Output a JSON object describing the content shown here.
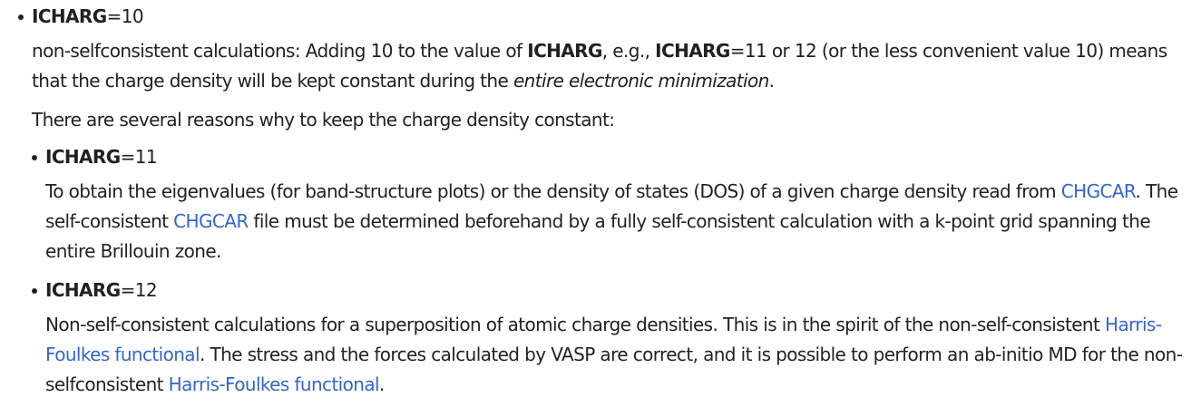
{
  "outer": {
    "param": "ICHARG",
    "value": "=10",
    "desc": {
      "t1": "non-selfconsistent calculations: Adding 10 to the value of ",
      "b1": "ICHARG",
      "t2": ", e.g., ",
      "b2": "ICHARG",
      "t3": "=11 or 12 (or the less convenient value 10) means that the charge density will be kept constant during the ",
      "em": "entire electronic minimization",
      "t4": "."
    },
    "reasons": "There are several reasons why to keep the charge density constant:"
  },
  "items": [
    {
      "param": "ICHARG",
      "value": "=11",
      "t1": "To obtain the eigenvalues (for band-structure plots) or the density of states (DOS) of a given charge density read from ",
      "link1": "CHGCAR",
      "t2": ". The self-consistent ",
      "link2": "CHGCAR",
      "t3": " file must be determined beforehand by a fully self-consistent calculation with a k-point grid spanning the entire Brillouin zone."
    },
    {
      "param": "ICHARG",
      "value": "=12",
      "t1": "Non-self-consistent calculations for a superposition of atomic charge densities. This is in the spirit of the non-self-consistent ",
      "link1": "Harris-Foulkes functional",
      "t2": ". The stress and the forces calculated by VASP are correct, and it is possible to perform an ab-initio MD for the non-selfconsistent ",
      "link2": "Harris-Foulkes functional",
      "t3": "."
    }
  ],
  "colors": {
    "text": "#202122",
    "link": "#3366cc"
  }
}
